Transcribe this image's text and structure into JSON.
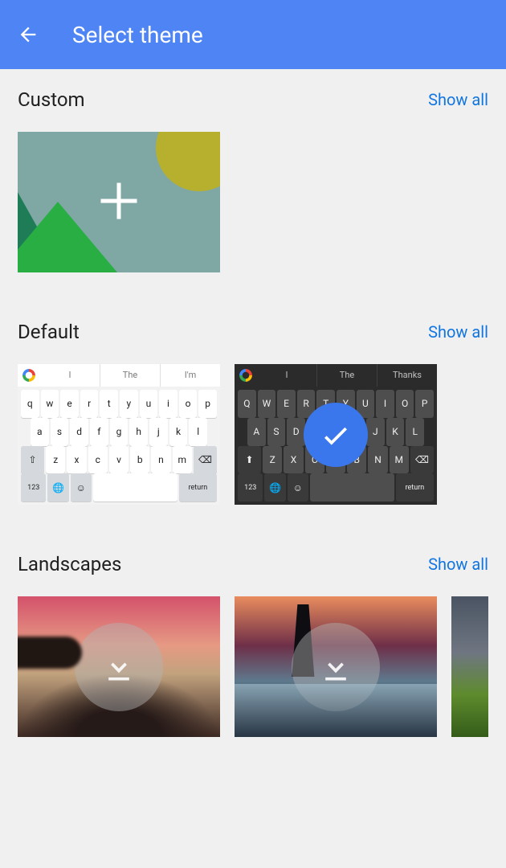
{
  "header": {
    "title": "Select theme"
  },
  "sections": {
    "custom": {
      "title": "Custom",
      "show_all": "Show all"
    },
    "default": {
      "title": "Default",
      "show_all": "Show all"
    },
    "landscapes": {
      "title": "Landscapes",
      "show_all": "Show all"
    }
  },
  "keyboard": {
    "suggestions_light": [
      "I",
      "The",
      "I'm"
    ],
    "suggestions_dark": [
      "I",
      "The",
      "Thanks"
    ],
    "row1": [
      "q",
      "w",
      "e",
      "r",
      "t",
      "y",
      "u",
      "i",
      "o",
      "p"
    ],
    "row2": [
      "a",
      "s",
      "d",
      "f",
      "g",
      "h",
      "j",
      "k",
      "l"
    ],
    "row3": [
      "z",
      "x",
      "c",
      "v",
      "b",
      "n",
      "m"
    ],
    "row1_upper": [
      "Q",
      "W",
      "E",
      "R",
      "T",
      "Y",
      "U",
      "I",
      "O",
      "P"
    ],
    "row2_upper": [
      "A",
      "S",
      "D",
      "F",
      "G",
      "H",
      "J",
      "K",
      "L"
    ],
    "row3_upper": [
      "Z",
      "X",
      "C",
      "V",
      "B",
      "N",
      "M"
    ],
    "key_123": "123",
    "key_return": "return"
  }
}
